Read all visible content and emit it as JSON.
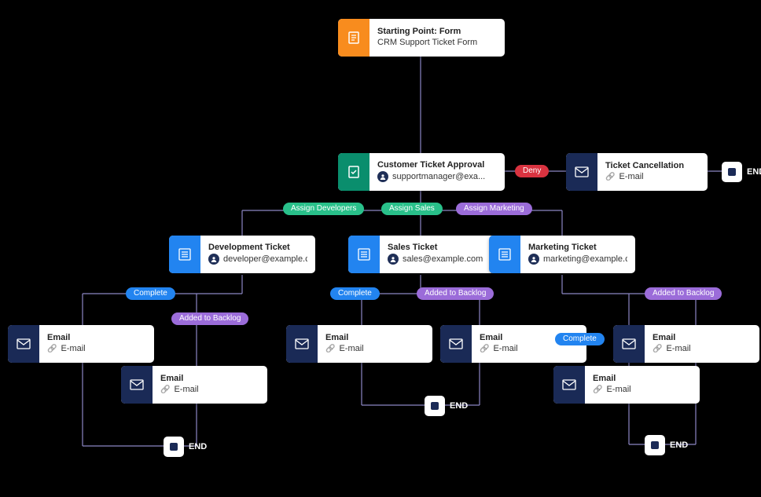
{
  "nodes": {
    "start": {
      "title": "Starting Point: Form",
      "sub": "CRM Support Ticket Form"
    },
    "approval": {
      "title": "Customer Ticket Approval",
      "sub": "supportmanager@exa..."
    },
    "cancellation": {
      "title": "Ticket Cancellation",
      "sub": "E-mail"
    },
    "dev": {
      "title": "Development Ticket",
      "sub": "developer@example.c..."
    },
    "sales": {
      "title": "Sales Ticket",
      "sub": "sales@example.com"
    },
    "marketing": {
      "title": "Marketing Ticket",
      "sub": "marketing@example.c..."
    },
    "email1": {
      "title": "Email",
      "sub": "E-mail"
    },
    "email2": {
      "title": "Email",
      "sub": "E-mail"
    },
    "email3": {
      "title": "Email",
      "sub": "E-mail"
    },
    "email4": {
      "title": "Email",
      "sub": "E-mail"
    },
    "email5": {
      "title": "Email",
      "sub": "E-mail"
    },
    "email6": {
      "title": "Email",
      "sub": "E-mail"
    }
  },
  "pills": {
    "deny": "Deny",
    "assign_dev": "Assign Developers",
    "assign_sales": "Assign Sales",
    "assign_marketing": "Assign Marketing",
    "complete1": "Complete",
    "backlog1": "Added to Backlog",
    "complete2": "Complete",
    "backlog2": "Added to Backlog",
    "complete3": "Complete",
    "backlog3": "Added to Backlog"
  },
  "end_label": "END",
  "colors": {
    "orange": "#f88c1e",
    "teal": "#0a8e6d",
    "blue": "#2284f0",
    "navy": "#1a2a56",
    "green_pill": "#29c08a",
    "purple_pill": "#9b6cd9",
    "red_pill": "#d93340",
    "blue_pill": "#2284f0",
    "line_purple": "#8b86c4"
  }
}
